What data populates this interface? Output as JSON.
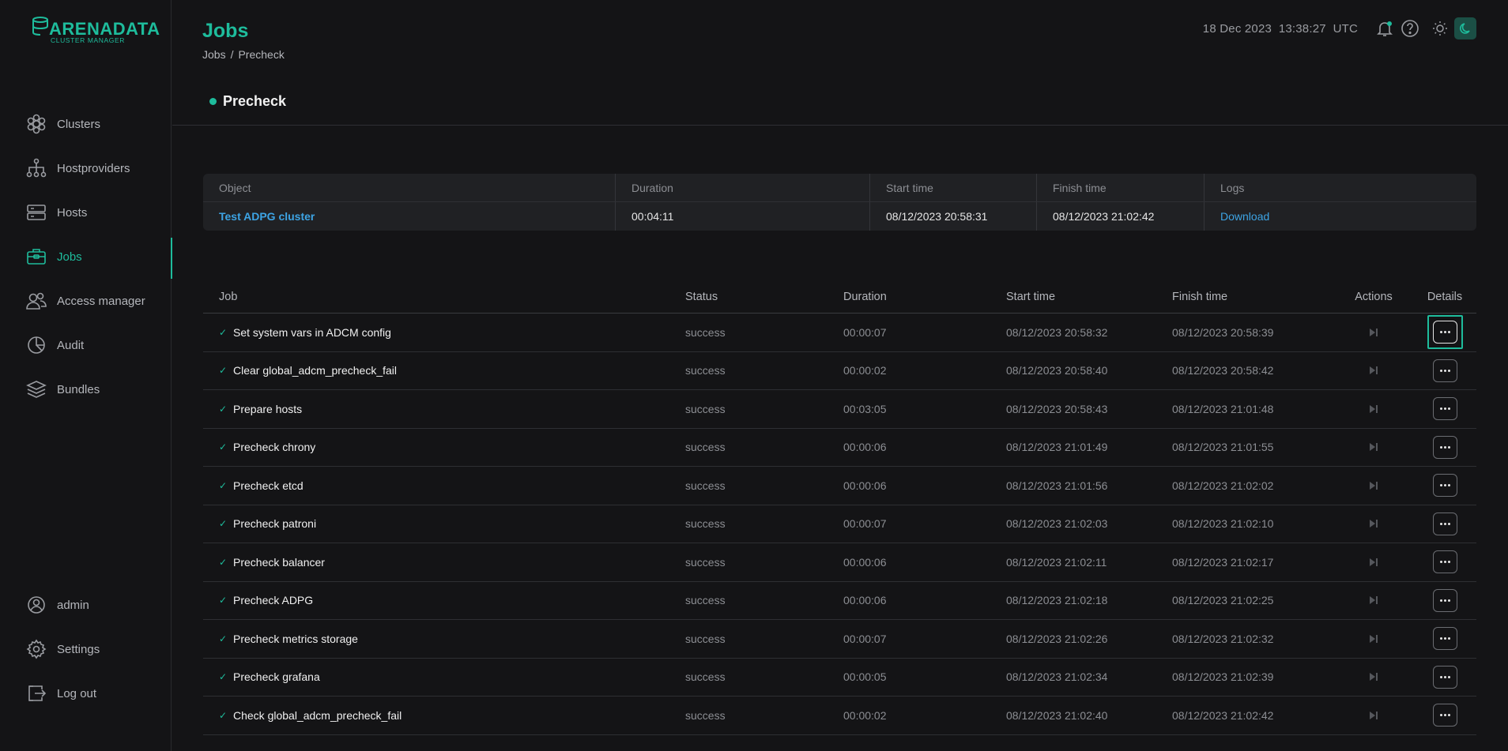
{
  "brand": {
    "name": "ARENADATA",
    "subtitle": "CLUSTER MANAGER"
  },
  "sidebar": {
    "items": [
      {
        "label": "Clusters",
        "icon": "clusters-icon",
        "active": false
      },
      {
        "label": "Hostproviders",
        "icon": "hostproviders-icon",
        "active": false
      },
      {
        "label": "Hosts",
        "icon": "hosts-icon",
        "active": false
      },
      {
        "label": "Jobs",
        "icon": "jobs-icon",
        "active": true
      },
      {
        "label": "Access manager",
        "icon": "access-manager-icon",
        "active": false
      },
      {
        "label": "Audit",
        "icon": "audit-icon",
        "active": false
      },
      {
        "label": "Bundles",
        "icon": "bundles-icon",
        "active": false
      }
    ],
    "bottom": [
      {
        "label": "admin",
        "icon": "user-icon"
      },
      {
        "label": "Settings",
        "icon": "gear-icon"
      },
      {
        "label": "Log out",
        "icon": "logout-icon"
      }
    ]
  },
  "header": {
    "title": "Jobs",
    "breadcrumb": [
      "Jobs",
      "/",
      "Precheck"
    ],
    "date": "18 Dec 2023",
    "time": "13:38:27",
    "tz": "UTC"
  },
  "job": {
    "name": "Precheck",
    "status_color": "#1ebc9c"
  },
  "summary": {
    "headers": [
      "Object",
      "Duration",
      "Start time",
      "Finish time",
      "Logs"
    ],
    "row": {
      "object": "Test ADPG cluster",
      "duration": "00:04:11",
      "start": "08/12/2023 20:58:31",
      "finish": "08/12/2023 21:02:42",
      "logs": "Download"
    }
  },
  "jobs": {
    "headers": [
      "Job",
      "Status",
      "Duration",
      "Start time",
      "Finish time",
      "Actions",
      "Details"
    ],
    "rows": [
      {
        "name": "Set system vars in ADCM config",
        "status": "success",
        "duration": "00:00:07",
        "start": "08/12/2023 20:58:32",
        "finish": "08/12/2023 20:58:39"
      },
      {
        "name": "Clear global_adcm_precheck_fail",
        "status": "success",
        "duration": "00:00:02",
        "start": "08/12/2023 20:58:40",
        "finish": "08/12/2023 20:58:42"
      },
      {
        "name": "Prepare hosts",
        "status": "success",
        "duration": "00:03:05",
        "start": "08/12/2023 20:58:43",
        "finish": "08/12/2023 21:01:48"
      },
      {
        "name": "Precheck chrony",
        "status": "success",
        "duration": "00:00:06",
        "start": "08/12/2023 21:01:49",
        "finish": "08/12/2023 21:01:55"
      },
      {
        "name": "Precheck etcd",
        "status": "success",
        "duration": "00:00:06",
        "start": "08/12/2023 21:01:56",
        "finish": "08/12/2023 21:02:02"
      },
      {
        "name": "Precheck patroni",
        "status": "success",
        "duration": "00:00:07",
        "start": "08/12/2023 21:02:03",
        "finish": "08/12/2023 21:02:10"
      },
      {
        "name": "Precheck balancer",
        "status": "success",
        "duration": "00:00:06",
        "start": "08/12/2023 21:02:11",
        "finish": "08/12/2023 21:02:17"
      },
      {
        "name": "Precheck ADPG",
        "status": "success",
        "duration": "00:00:06",
        "start": "08/12/2023 21:02:18",
        "finish": "08/12/2023 21:02:25"
      },
      {
        "name": "Precheck metrics storage",
        "status": "success",
        "duration": "00:00:07",
        "start": "08/12/2023 21:02:26",
        "finish": "08/12/2023 21:02:32"
      },
      {
        "name": "Precheck grafana",
        "status": "success",
        "duration": "00:00:05",
        "start": "08/12/2023 21:02:34",
        "finish": "08/12/2023 21:02:39"
      },
      {
        "name": "Check global_adcm_precheck_fail",
        "status": "success",
        "duration": "00:00:02",
        "start": "08/12/2023 21:02:40",
        "finish": "08/12/2023 21:02:42"
      }
    ]
  },
  "colors": {
    "accent": "#1ebc9c",
    "link": "#3da4e4",
    "background": "#141416"
  }
}
